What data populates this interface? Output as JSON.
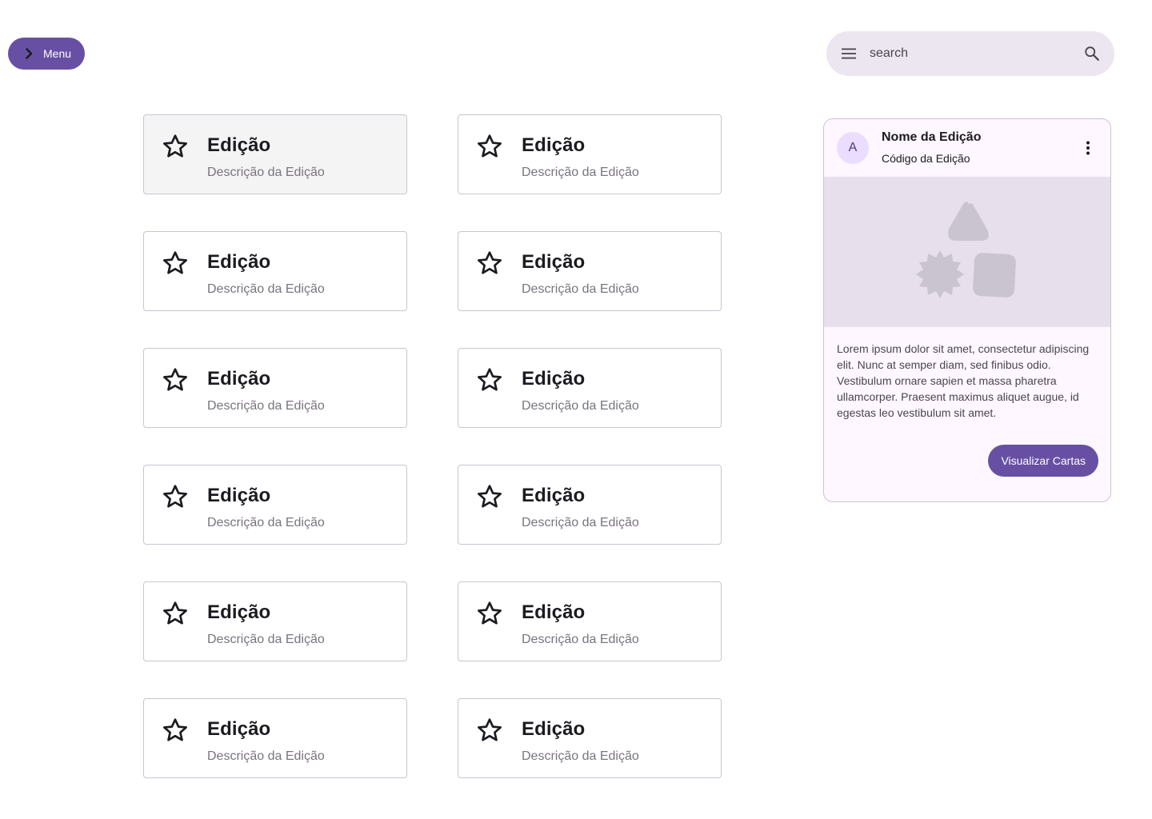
{
  "menu": {
    "label": "Menu",
    "icon": "chevron-right-icon"
  },
  "search": {
    "placeholder": "search",
    "value": "",
    "leading_icon": "hamburger-icon",
    "trailing_icon": "search-icon"
  },
  "editions": [
    {
      "title": "Edição",
      "description": "Descrição da Edição",
      "selected": true
    },
    {
      "title": "Edição",
      "description": "Descrição da Edição",
      "selected": false
    },
    {
      "title": "Edição",
      "description": "Descrição da Edição",
      "selected": false
    },
    {
      "title": "Edição",
      "description": "Descrição da Edição",
      "selected": false
    },
    {
      "title": "Edição",
      "description": "Descrição da Edição",
      "selected": false
    },
    {
      "title": "Edição",
      "description": "Descrição da Edição",
      "selected": false
    },
    {
      "title": "Edição",
      "description": "Descrição da Edição",
      "selected": false
    },
    {
      "title": "Edição",
      "description": "Descrição da Edição",
      "selected": false
    },
    {
      "title": "Edição",
      "description": "Descrição da Edição",
      "selected": false
    },
    {
      "title": "Edição",
      "description": "Descrição da Edição",
      "selected": false
    },
    {
      "title": "Edição",
      "description": "Descrição da Edição",
      "selected": false
    },
    {
      "title": "Edição",
      "description": "Descrição da Edição",
      "selected": false
    }
  ],
  "detail": {
    "avatar_letter": "A",
    "title": "Nome da Edição",
    "subtitle": "Código da Edição",
    "body": "Lorem ipsum dolor sit amet, consectetur adipiscing elit. Nunc at semper diam, sed finibus odio. Vestibulum ornare sapien et massa pharetra ullamcorper. Praesent maximus aliquet augue, id egestas leo vestibulum sit amet.",
    "button_label": "Visualizar Cartas",
    "media_icon": "image-placeholder-shapes-icon"
  },
  "colors": {
    "primary": "#6750a4",
    "surface_variant": "#ece6f0",
    "card_border": "#cac4d0",
    "selected_card_bg": "#f4f4f4"
  }
}
